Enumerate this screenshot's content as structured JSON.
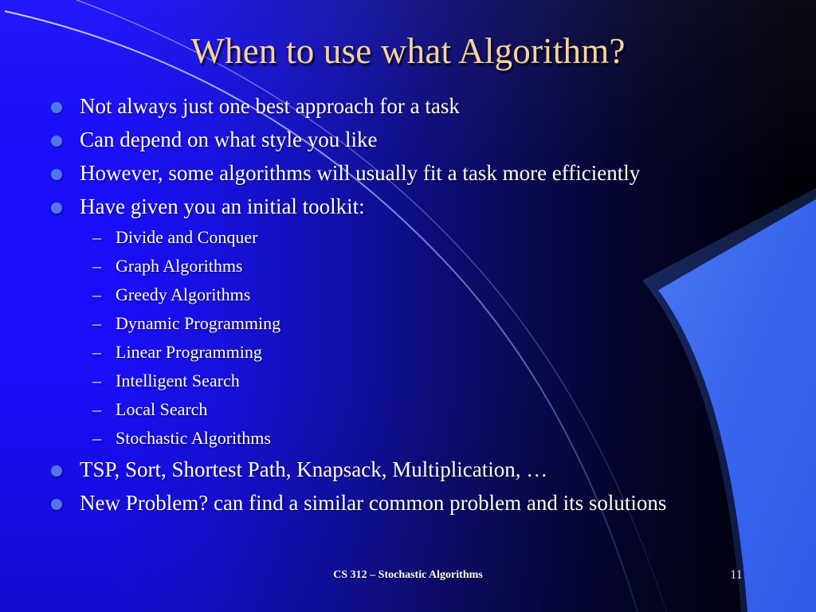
{
  "slide": {
    "title": "When to use what Algorithm?",
    "bullet_marker": "●",
    "sub_marker": "–",
    "content": [
      {
        "level": 1,
        "text": "Not always just one best approach for a task"
      },
      {
        "level": 1,
        "text": "Can depend on what style you like"
      },
      {
        "level": 1,
        "text": "However, some algorithms will usually fit a task more efficiently"
      },
      {
        "level": 1,
        "text": "Have given you an initial toolkit:"
      },
      {
        "level": 2,
        "text": "Divide and Conquer"
      },
      {
        "level": 2,
        "text": "Graph Algorithms"
      },
      {
        "level": 2,
        "text": "Greedy Algorithms"
      },
      {
        "level": 2,
        "text": "Dynamic Programming"
      },
      {
        "level": 2,
        "text": "Linear Programming"
      },
      {
        "level": 2,
        "text": "Intelligent Search"
      },
      {
        "level": 2,
        "text": "Local Search"
      },
      {
        "level": 2,
        "text": "Stochastic Algorithms"
      },
      {
        "level": 1,
        "text": "TSP, Sort, Shortest Path, Knapsack, Multiplication, …"
      },
      {
        "level": 1,
        "text": "New Problem? can find a similar common problem and its solutions"
      }
    ],
    "footer": {
      "text": "CS 312 – Stochastic Algorithms",
      "slide_number": "11"
    },
    "colors": {
      "title": "#f7d39a",
      "body_text": "#ffffff",
      "bullet": "#5076ee",
      "background_left": "#1a0df7",
      "background_right": "#000008",
      "swoosh": "#3a66ee",
      "hairline": "#8fa8f5"
    }
  }
}
